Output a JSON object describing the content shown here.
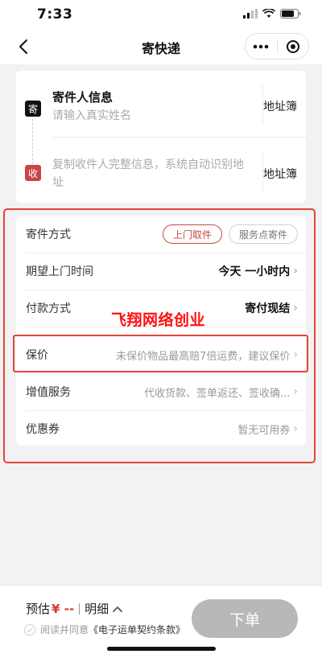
{
  "status": {
    "time": "7:33"
  },
  "nav": {
    "title": "寄快递"
  },
  "sender": {
    "badge": "寄",
    "title": "寄件人信息",
    "placeholder": "请输入真实姓名",
    "address_book": "地址簿"
  },
  "receiver": {
    "badge": "收",
    "hint": "复制收件人完整信息，系统自动识别地址",
    "address_book": "地址簿"
  },
  "options": {
    "method": {
      "label": "寄件方式",
      "choices": [
        "上门取件",
        "服务点寄件"
      ],
      "selected": "上门取件"
    },
    "time": {
      "label": "期望上门时间",
      "value": "今天 一小时内"
    },
    "payment": {
      "label": "付款方式",
      "value": "寄付现结"
    },
    "insurance": {
      "label": "保价",
      "hint": "未保价物品最高赔7倍运费，建议保价"
    },
    "value_added": {
      "label": "增值服务",
      "hint": "代收货款、签单返还、签收确..."
    },
    "coupon": {
      "label": "优惠券",
      "hint": "暂无可用券"
    }
  },
  "watermark": "飞翔网络创业",
  "bottom": {
    "estimate_label": "预估",
    "price": "¥ -- ",
    "detail": "明细",
    "agree_text": "阅读并同意",
    "agree_link": "《电子运单契约条款》",
    "order_button": "下单"
  },
  "colors": {
    "accent_red": "#c84a3c",
    "highlight_red": "#e0453a",
    "watermark_red": "#ff1010",
    "button_disabled": "#b8b8b8"
  }
}
